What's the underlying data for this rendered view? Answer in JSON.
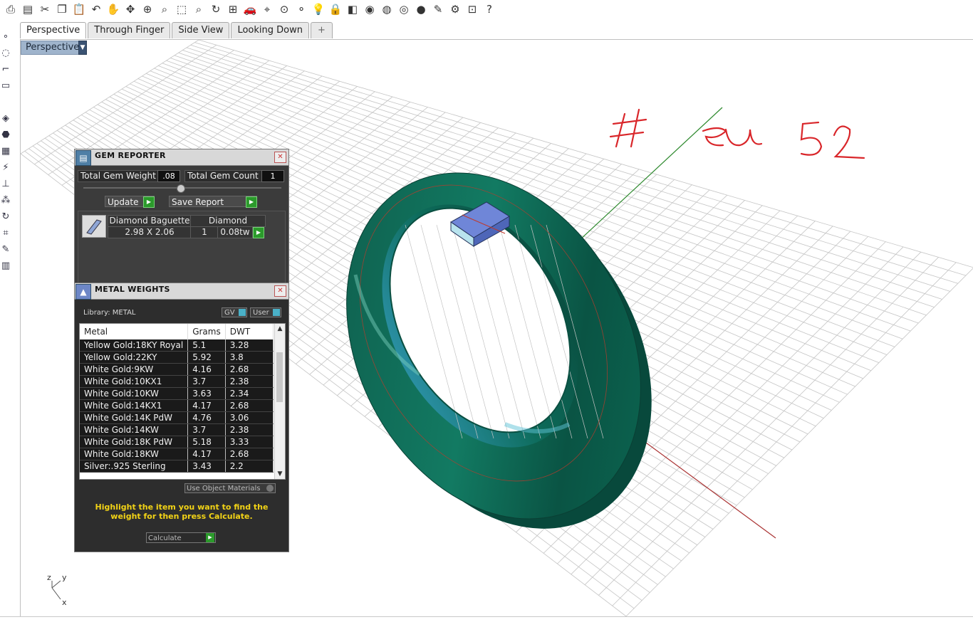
{
  "toolbar": {
    "icons": [
      "print-icon",
      "new-icon",
      "cut-icon",
      "copy-icon",
      "paste-icon",
      "undo-icon",
      "pan-icon",
      "move-icon",
      "zoom-icon",
      "zoom-window-icon",
      "zoom-extents-icon",
      "zoom-selected-icon",
      "rotate-view-icon",
      "four-viewports-icon",
      "car-icon",
      "snap-icon",
      "point-icon",
      "osnap-icon",
      "light-icon",
      "lock-icon",
      "layer-icon",
      "color-wheel-icon",
      "sphere-wire-icon",
      "sphere-shaded-icon",
      "render-sphere-icon",
      "paint-icon",
      "gear-icon",
      "grid-select-icon",
      "help-icon"
    ],
    "glyphs": [
      "⎙",
      "▤",
      "✂",
      "❐",
      "📋",
      "↶",
      "✋",
      "✥",
      "⊕",
      "⌕",
      "⬚",
      "⌕",
      "↻",
      "⊞",
      "🚗",
      "⌖",
      "⊙",
      "⚬",
      "💡",
      "🔒",
      "◧",
      "◉",
      "◍",
      "◎",
      "●",
      "✎",
      "⚙",
      "⊡",
      "?"
    ]
  },
  "tabs": [
    "Perspective",
    "Through Finger",
    "Side View",
    "Looking Down",
    "+"
  ],
  "viewport": {
    "label": "Perspective",
    "annotation": "# eu 52"
  },
  "axes": {
    "x": "x",
    "y": "y",
    "z": "z"
  },
  "gem_reporter": {
    "title": "GEM REPORTER",
    "total_gem_weight_label": "Total Gem Weight",
    "total_gem_weight": ".08",
    "total_gem_count_label": "Total Gem Count",
    "total_gem_count": "1",
    "update_label": "Update",
    "save_report_label": "Save Report",
    "gem": {
      "cut": "Diamond Baguette",
      "material": "Diamond",
      "size": "2.98 X 2.06",
      "count": "1",
      "weight": "0.08tw"
    }
  },
  "metal_weights": {
    "title": "METAL WEIGHTS",
    "library_label": "Library: METAL",
    "gv_label": "GV",
    "user_label": "User",
    "columns": [
      "Metal",
      "Grams",
      "DWT"
    ],
    "rows": [
      [
        "Yellow Gold:18KY Royal",
        "5.1",
        "3.28"
      ],
      [
        "Yellow Gold:22KY",
        "5.92",
        "3.8"
      ],
      [
        "White Gold:9KW",
        "4.16",
        "2.68"
      ],
      [
        "White Gold:10KX1",
        "3.7",
        "2.38"
      ],
      [
        "White Gold:10KW",
        "3.63",
        "2.34"
      ],
      [
        "White Gold:14KX1",
        "4.17",
        "2.68"
      ],
      [
        "White Gold:14K PdW",
        "4.76",
        "3.06"
      ],
      [
        "White Gold:14KW",
        "3.7",
        "2.38"
      ],
      [
        "White Gold:18K PdW",
        "5.18",
        "3.33"
      ],
      [
        "White Gold:18KW",
        "4.17",
        "2.68"
      ],
      [
        "Silver:.925 Sterling",
        "3.43",
        "2.2"
      ]
    ],
    "use_object_materials_label": "Use Object Materials",
    "hint": "Highlight the item you want to find the weight for then press Calculate.",
    "calculate_label": "Calculate"
  },
  "colors": {
    "ring": "#0f6b56",
    "grid": "#c4c4c4",
    "annotation": "#d9262a",
    "hint": "#f2d316"
  }
}
